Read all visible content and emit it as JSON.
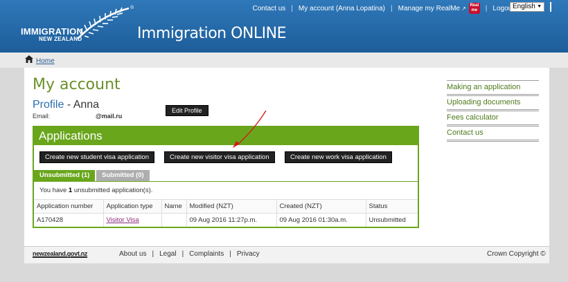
{
  "header": {
    "logo_line1": "IMMIGRATION",
    "logo_line2": "NEW ZEALAND",
    "registered": "®",
    "site_title": "Immigration ONLINE",
    "nav": {
      "contact": "Contact us",
      "account": "My account (Anna Lopatina)",
      "realme": "Manage my RealMe",
      "realme_badge_top": "Real",
      "realme_badge_bottom": "me",
      "logout": "Logout"
    },
    "language": "English"
  },
  "breadcrumb": {
    "home": "Home"
  },
  "account": {
    "title": "My account",
    "profile_word": "Profile",
    "profile_name": "- Anna",
    "email_label": "Email:",
    "email_value": "@mail.ru",
    "edit_profile": "Edit Profile"
  },
  "applications": {
    "title": "Applications",
    "buttons": {
      "student": "Create new student visa application",
      "visitor": "Create new visitor visa application",
      "work": "Create new work visa application"
    },
    "tabs": {
      "unsubmitted": "Unsubmitted (1)",
      "submitted": "Submitted (0)"
    },
    "summary_pre": "You have ",
    "summary_count": "1",
    "summary_post": " unsubmitted application(s).",
    "columns": [
      "Application number",
      "Application type",
      "Name",
      "Modified (NZT)",
      "Created (NZT)",
      "Status"
    ],
    "rows": [
      {
        "number": "A170428",
        "type": "Visitor Visa",
        "name": "",
        "modified": "09 Aug 2016 11:27p.m.",
        "created": "09 Aug 2016 01:30a.m.",
        "status": "Unsubmitted"
      }
    ]
  },
  "sidebar": {
    "items": [
      "Making an application",
      "Uploading documents",
      "Fees calculator",
      "Contact us"
    ]
  },
  "footer": {
    "govt": "newzealand.govt.nz",
    "links": [
      "About us",
      "Legal",
      "Complaints",
      "Privacy"
    ],
    "copyright": "Crown Copyright ©"
  },
  "colors": {
    "header_blue": "#2f78b9",
    "brand_green": "#6aa61c",
    "annotation_red": "#d0191b"
  }
}
